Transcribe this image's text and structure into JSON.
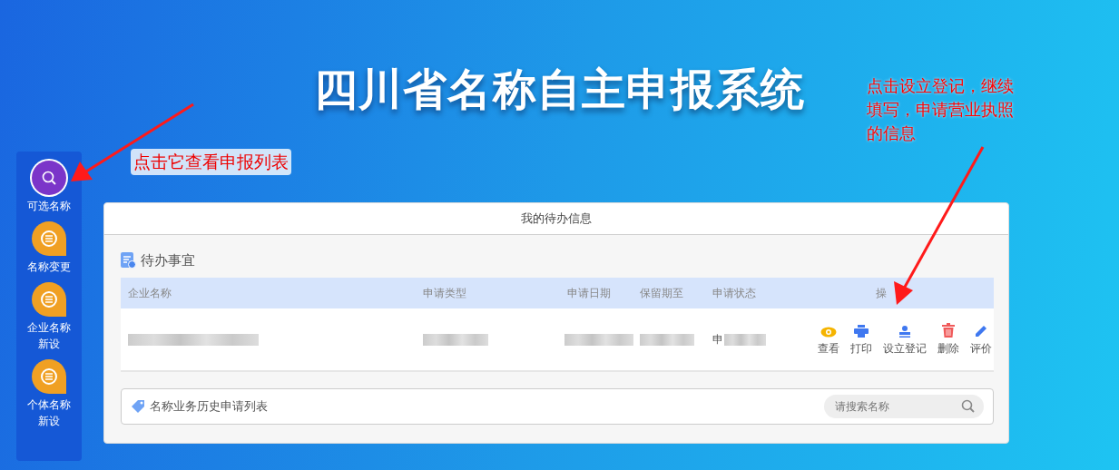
{
  "title": "四川省名称自主申报系统",
  "sidebar": {
    "items": [
      {
        "label": "可选名称",
        "kind": "search",
        "selected": true
      },
      {
        "label": "名称变更",
        "kind": "list",
        "selected": false
      },
      {
        "label": "企业名称新设",
        "kind": "list",
        "selected": false
      },
      {
        "label": "个体名称新设",
        "kind": "list",
        "selected": false
      }
    ]
  },
  "card": {
    "title": "我的待办信息",
    "todo": {
      "heading": "待办事宜",
      "columns": [
        "企业名称",
        "申请类型",
        "申请日期",
        "保留期至",
        "申请状态",
        "操"
      ],
      "rows": [
        {
          "status_prefix": "申",
          "actions": [
            {
              "kind": "view",
              "label": "查看"
            },
            {
              "kind": "print",
              "label": "打印"
            },
            {
              "kind": "register",
              "label": "设立登记"
            },
            {
              "kind": "delete",
              "label": "删除"
            },
            {
              "kind": "rate",
              "label": "评价"
            }
          ]
        }
      ]
    },
    "history": {
      "heading": "名称业务历史申请列表",
      "search": {
        "placeholder": "请搜索名称"
      }
    }
  },
  "annotations": [
    {
      "text": "点击它查看申报列表"
    },
    {
      "text": "点击设立登记，继续填写，申请营业执照的信息"
    }
  ]
}
